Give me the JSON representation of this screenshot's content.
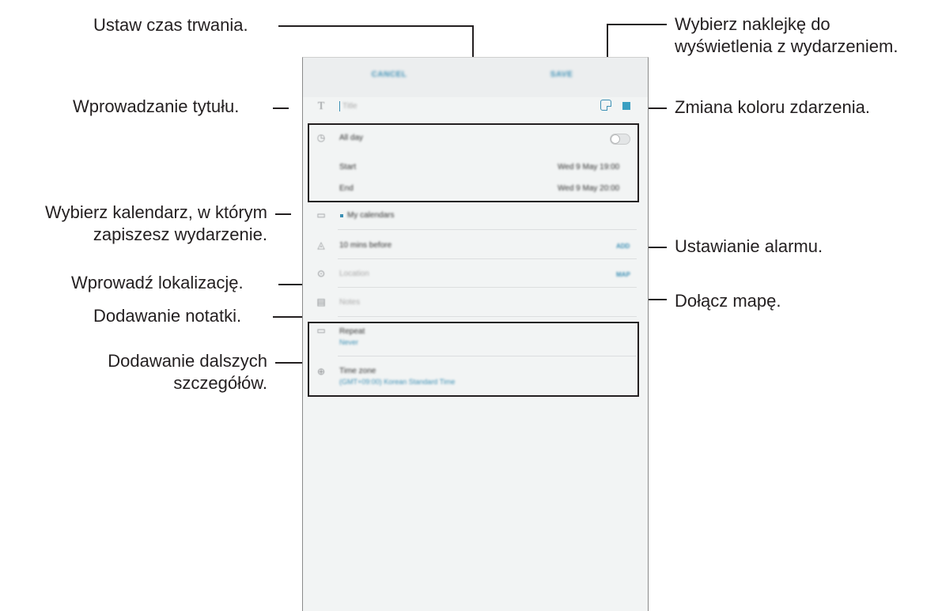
{
  "callouts": {
    "duration": "Ustaw czas trwania.",
    "title_input": "Wprowadzanie tytułu.",
    "calendar_line1": "Wybierz kalendarz, w którym",
    "calendar_line2": "zapiszesz wydarzenie.",
    "location": "Wprowadź lokalizację.",
    "notes": "Dodawanie notatki.",
    "details_line1": "Dodawanie dalszych",
    "details_line2": "szczegółów.",
    "sticker_line1": "Wybierz naklejkę do",
    "sticker_line2": "wyświetlenia z wydarzeniem.",
    "color": "Zmiana koloru zdarzenia.",
    "alarm": "Ustawianie alarmu.",
    "map": "Dołącz mapę."
  },
  "screen": {
    "cancel_label": "CANCEL",
    "save_label": "SAVE",
    "title_placeholder": "Title",
    "all_day_label": "All day",
    "start_label": "Start",
    "start_value": "Wed 9 May   19:00",
    "end_label": "End",
    "end_value": "Wed 9 May   20:00",
    "calendar_label": "My calendars",
    "reminder_label": "10 mins before",
    "reminder_add": "ADD",
    "location_placeholder": "Location",
    "map_label": "MAP",
    "notes_placeholder": "Notes",
    "repeat_label": "Repeat",
    "repeat_value": "Never",
    "timezone_label": "Time zone",
    "timezone_value": "(GMT+09:00) Korean Standard Time"
  },
  "icons": {
    "title": "text-icon",
    "time": "clock-icon",
    "calendar": "calendar-icon",
    "reminder": "bell-icon",
    "location": "pin-icon",
    "notes": "notes-icon",
    "repeat": "repeat-icon",
    "timezone": "globe-icon"
  },
  "colors": {
    "accent": "#3c8fb4",
    "event_color": "#3a9fc2"
  }
}
